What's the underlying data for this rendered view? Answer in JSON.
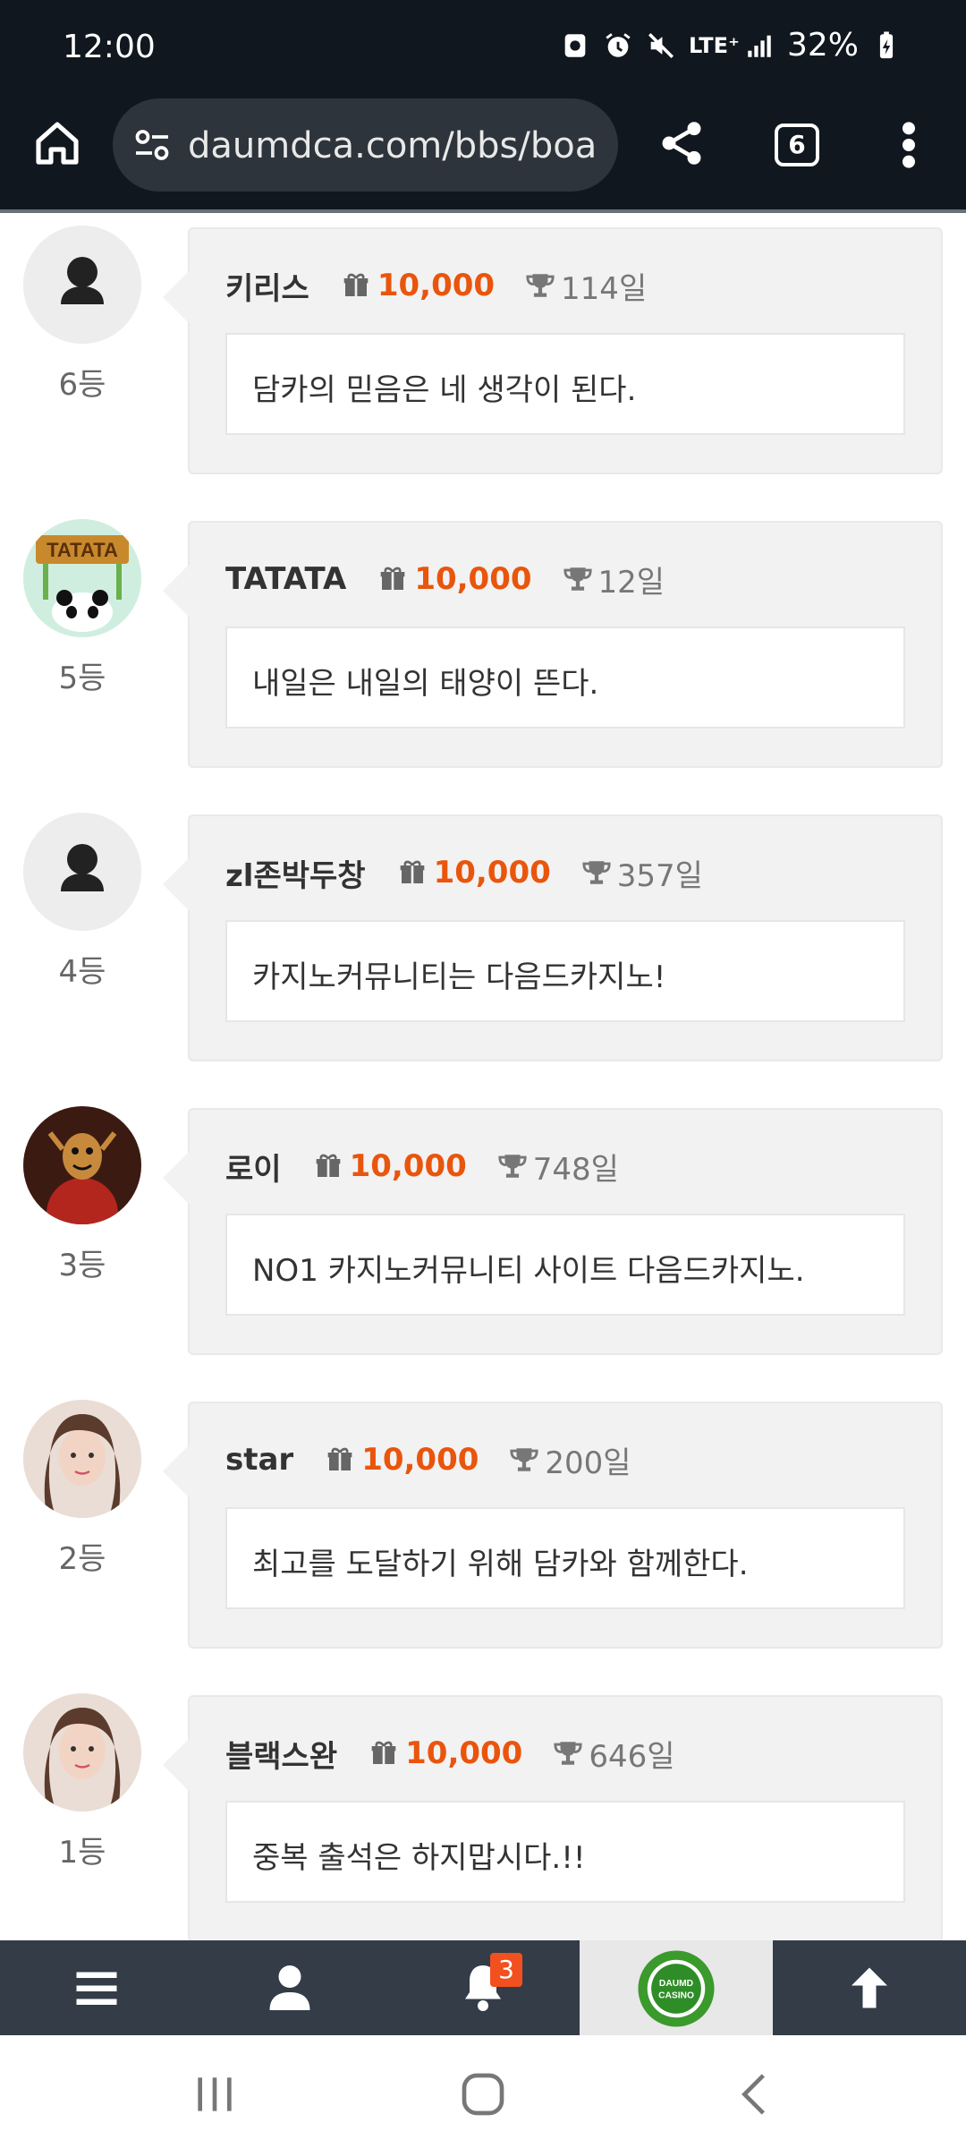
{
  "status_bar": {
    "time": "12:00",
    "network": "LTE⁺",
    "battery": "32%"
  },
  "browser": {
    "url": "daumdca.com/bbs/boa",
    "tab_count": "6"
  },
  "entries": [
    {
      "name": "키리스",
      "points": "10,000",
      "days": "114일",
      "message": "담카의 믿음은 네 생각이 된다.",
      "rank": "6등",
      "avatar": "default-avatar"
    },
    {
      "name": "TATATA",
      "points": "10,000",
      "days": "12일",
      "message": "내일은 내일의 태양이 뜬다.",
      "rank": "5등",
      "avatar": "panda-avatar",
      "avatar_text": "TATATA"
    },
    {
      "name": "zl존박두창",
      "points": "10,000",
      "days": "357일",
      "message": "카지노커뮤니티는 다음드카지노!",
      "rank": "4등",
      "avatar": "default-avatar"
    },
    {
      "name": "로이",
      "points": "10,000",
      "days": "748일",
      "message": "NO1 카지노커뮤니티 사이트 다음드카지노.",
      "rank": "3등",
      "avatar": "cartoon-avatar"
    },
    {
      "name": "star",
      "points": "10,000",
      "days": "200일",
      "message": "최고를 도달하기 위해 담카와 함께한다.",
      "rank": "2등",
      "avatar": "photo-avatar"
    },
    {
      "name": "블랙스완",
      "points": "10,000",
      "days": "646일",
      "message": "중복 출석은 하지맙시다.!!",
      "rank": "1등",
      "avatar": "photo-avatar"
    }
  ],
  "bottom_nav": {
    "notification_count": "3",
    "logo_text_line1": "DAUMD",
    "logo_text_line2": "CASINO"
  },
  "colors": {
    "points": "#e9550c",
    "top_bar": "#10171e",
    "bottom_nav": "#333c47",
    "badge": "#f2501f"
  }
}
